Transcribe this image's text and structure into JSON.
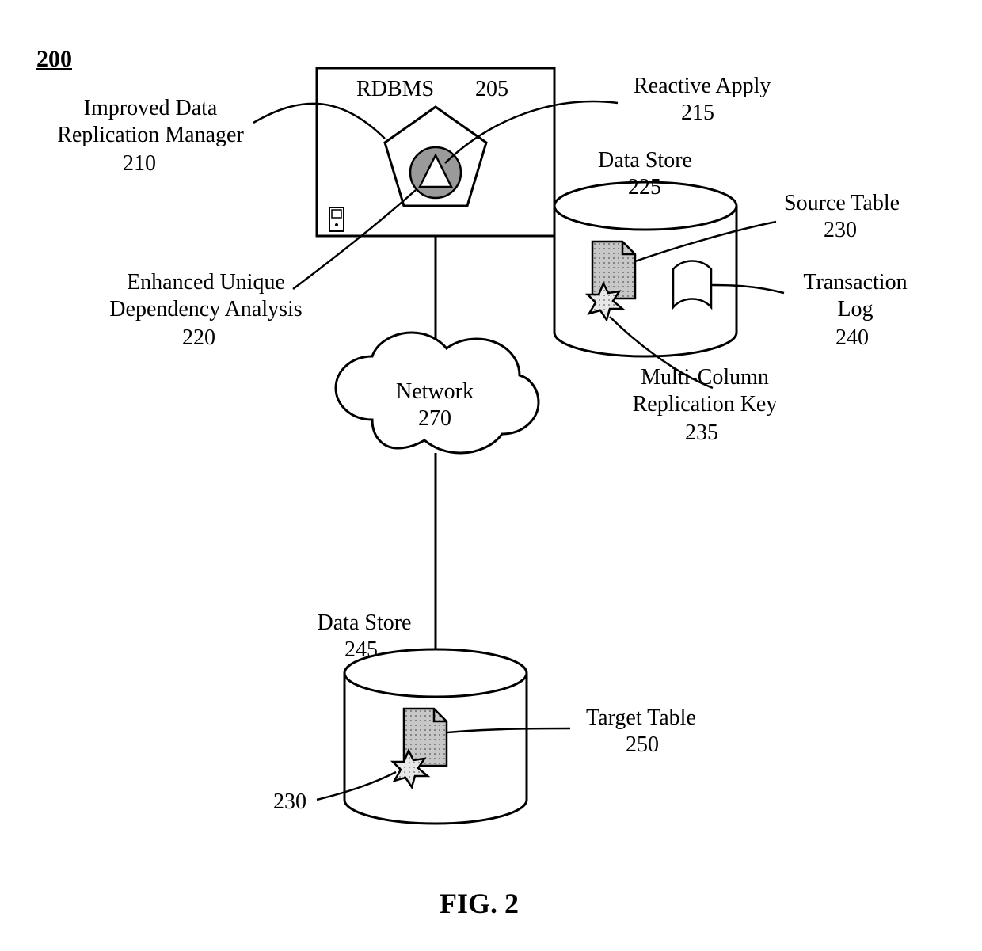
{
  "figure_ref": "200",
  "figure_caption": "FIG. 2",
  "rdbms": {
    "label": "RDBMS",
    "num": "205"
  },
  "replication_mgr": {
    "label": "Improved Data\nReplication Manager",
    "num": "210"
  },
  "reactive_apply": {
    "label": "Reactive Apply",
    "num": "215"
  },
  "dep_analysis": {
    "label": "Enhanced Unique\nDependency Analysis",
    "num": "220"
  },
  "data_store_top": {
    "label": "Data Store",
    "num": "225"
  },
  "source_table": {
    "label": "Source Table",
    "num": "230"
  },
  "replication_key": {
    "label": "Multi-Column\nReplication Key",
    "num": "235"
  },
  "transaction_log": {
    "label": "Transaction\nLog",
    "num": "240"
  },
  "data_store_bottom": {
    "label": "Data Store",
    "num": "245"
  },
  "target_table": {
    "label": "Target Table",
    "num": "250"
  },
  "bottom_ref": {
    "num": "230"
  },
  "network": {
    "label": "Network",
    "num": "270"
  }
}
